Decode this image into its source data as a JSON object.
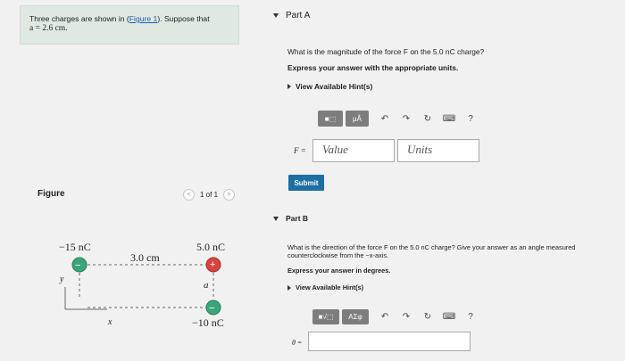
{
  "problem": {
    "text_before": "Three charges are shown in (",
    "link": "Figure 1",
    "text_after": "). Suppose that",
    "condition": "a = 2.6 cm."
  },
  "figure": {
    "label": "Figure",
    "pager": {
      "prev": "<",
      "text": "1 of 1",
      "next": ">"
    },
    "charges": [
      {
        "label": "−15 nC",
        "sign": "−",
        "color": "#3aa57a"
      },
      {
        "label": "5.0 nC",
        "sign": "+",
        "color": "#d8433e"
      },
      {
        "label": "−10 nC",
        "sign": "−",
        "color": "#3aa57a"
      }
    ],
    "distance_label": "3.0 cm",
    "a_label": "a",
    "x_axis": "x",
    "y_axis": "y"
  },
  "partA": {
    "title": "Part A",
    "question": "What is the magnitude of the force F on the 5.0 nC charge?",
    "instruction": "Express your answer with the appropriate units.",
    "hint": "View Available Hint(s)",
    "toolbar": {
      "btn1": "■⬚",
      "btn2": "μÅ",
      "undo": "↶",
      "redo": "↷",
      "reset": "↻",
      "keyboard": "⌨",
      "help": "?"
    },
    "eq_label": "F =",
    "value_placeholder": "Value",
    "units_placeholder": "Units",
    "submit": "Submit"
  },
  "partB": {
    "title": "Part B",
    "question_l1": "What is the direction of the force F on the 5.0 nC charge? Give your answer as an angle measured",
    "question_l2": "counterclockwise from the −x-axis.",
    "instruction": "Express your answer in degrees.",
    "hint": "View Available Hint(s)",
    "toolbar": {
      "btn1": "■√⬚",
      "btn2": "AΣφ",
      "undo": "↶",
      "redo": "↷",
      "reset": "↻",
      "keyboard": "⌨",
      "help": "?"
    },
    "eq_label": "θ ="
  }
}
